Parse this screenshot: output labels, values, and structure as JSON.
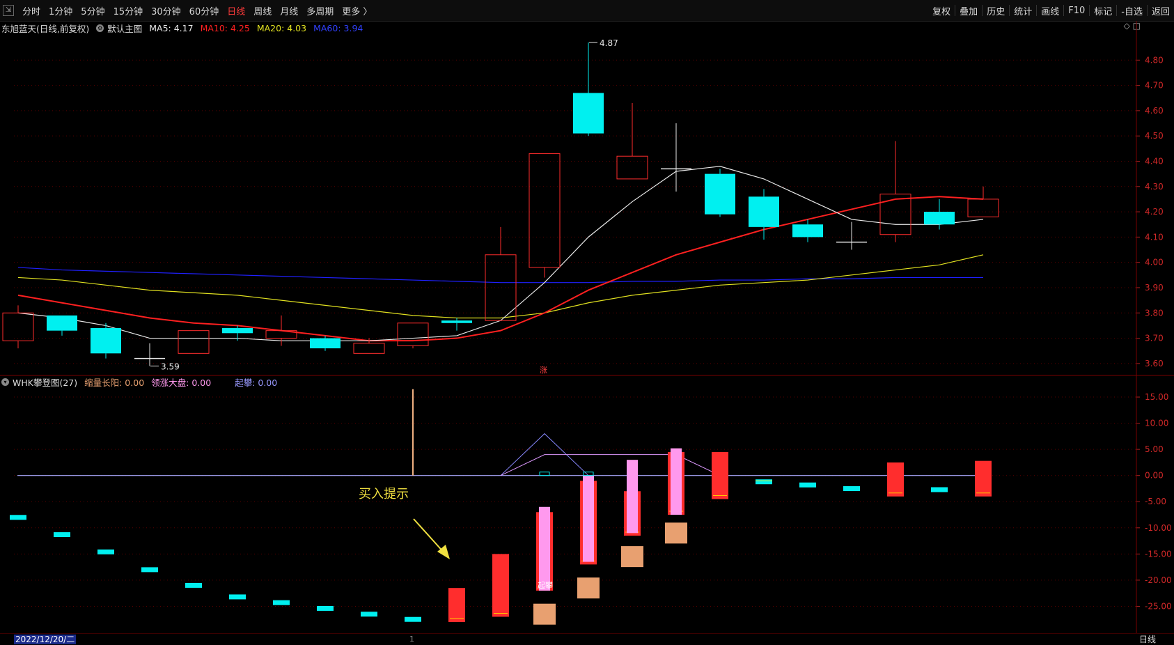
{
  "toolbar": {
    "periods": [
      "分时",
      "1分钟",
      "5分钟",
      "15分钟",
      "30分钟",
      "60分钟",
      "日线",
      "周线",
      "月线",
      "多周期",
      "更多 〉"
    ],
    "active_index": 6,
    "right": [
      "复权",
      "叠加",
      "历史",
      "统计",
      "画线",
      "F10",
      "标记",
      "-自选",
      "返回"
    ]
  },
  "info": {
    "stock": "东旭蓝天(日线,前复权)",
    "main_chart": "默认主图",
    "ma5": "MA5: 4.17",
    "ma10": "MA10: 4.25",
    "ma20": "MA20: 4.03",
    "ma60": "MA60: 3.94"
  },
  "indicator": {
    "name": "WHK攀登图(27)",
    "v1": "缩量长阳: 0.00",
    "v2": "领涨大盘: 0.00",
    "v3": "起攀: 0.00"
  },
  "colors": {
    "up": "#ff2d2d",
    "down": "#00f0f0",
    "ma5": "#e8e8e8",
    "ma10": "#ff2020",
    "ma20": "#e0e020",
    "ma60": "#2020ff",
    "pink": "#ff99ee",
    "orange": "#e8a070"
  },
  "chart_data": [
    {
      "type": "candlestick",
      "ylim": [
        3.55,
        4.9
      ],
      "ticks": [
        "4.80",
        "4.70",
        "4.60",
        "4.50",
        "4.40",
        "4.30",
        "4.20",
        "4.10",
        "4.00",
        "3.90",
        "3.80",
        "3.70",
        "3.60"
      ],
      "tick_values": [
        4.8,
        4.7,
        4.6,
        4.5,
        4.4,
        4.3,
        4.2,
        4.1,
        4.0,
        3.9,
        3.8,
        3.7,
        3.6
      ],
      "candles": [
        {
          "o": 3.69,
          "c": 3.8,
          "h": 3.83,
          "l": 3.66
        },
        {
          "o": 3.79,
          "c": 3.73,
          "h": 3.79,
          "l": 3.71
        },
        {
          "o": 3.74,
          "c": 3.64,
          "h": 3.76,
          "l": 3.62
        },
        {
          "o": 3.62,
          "c": 3.62,
          "h": 3.68,
          "l": 3.59
        },
        {
          "o": 3.64,
          "c": 3.73,
          "h": 3.73,
          "l": 3.64
        },
        {
          "o": 3.74,
          "c": 3.72,
          "h": 3.75,
          "l": 3.69
        },
        {
          "o": 3.7,
          "c": 3.73,
          "h": 3.79,
          "l": 3.67
        },
        {
          "o": 3.7,
          "c": 3.66,
          "h": 3.71,
          "l": 3.65
        },
        {
          "o": 3.64,
          "c": 3.68,
          "h": 3.7,
          "l": 3.64
        },
        {
          "o": 3.67,
          "c": 3.76,
          "h": 3.76,
          "l": 3.66
        },
        {
          "o": 3.77,
          "c": 3.76,
          "h": 3.78,
          "l": 3.73
        },
        {
          "o": 3.77,
          "c": 4.03,
          "h": 4.14,
          "l": 3.77
        },
        {
          "o": 3.98,
          "c": 4.43,
          "h": 4.43,
          "l": 3.94
        },
        {
          "o": 4.67,
          "c": 4.51,
          "h": 4.87,
          "l": 4.5
        },
        {
          "o": 4.33,
          "c": 4.42,
          "h": 4.63,
          "l": 4.33
        },
        {
          "o": 4.37,
          "c": 4.37,
          "h": 4.55,
          "l": 4.28
        },
        {
          "o": 4.35,
          "c": 4.19,
          "h": 4.37,
          "l": 4.18
        },
        {
          "o": 4.26,
          "c": 4.14,
          "h": 4.29,
          "l": 4.09
        },
        {
          "o": 4.15,
          "c": 4.1,
          "h": 4.17,
          "l": 4.08
        },
        {
          "o": 4.08,
          "c": 4.08,
          "h": 4.16,
          "l": 4.05
        },
        {
          "o": 4.11,
          "c": 4.27,
          "h": 4.48,
          "l": 4.08
        },
        {
          "o": 4.2,
          "c": 4.15,
          "h": 4.25,
          "l": 4.13
        },
        {
          "o": 4.18,
          "c": 4.25,
          "h": 4.3,
          "l": 4.18
        }
      ],
      "ma5": [
        3.8,
        3.78,
        3.75,
        3.7,
        3.7,
        3.7,
        3.69,
        3.69,
        3.69,
        3.7,
        3.71,
        3.77,
        3.92,
        4.1,
        4.24,
        4.36,
        4.38,
        4.33,
        4.25,
        4.17,
        4.15,
        4.15,
        4.17
      ],
      "ma10": [
        3.87,
        3.84,
        3.81,
        3.78,
        3.76,
        3.75,
        3.73,
        3.71,
        3.69,
        3.69,
        3.7,
        3.73,
        3.8,
        3.89,
        3.96,
        4.03,
        4.08,
        4.13,
        4.17,
        4.21,
        4.25,
        4.26,
        4.25
      ],
      "ma20": [
        3.94,
        3.93,
        3.91,
        3.89,
        3.88,
        3.87,
        3.85,
        3.83,
        3.81,
        3.79,
        3.78,
        3.78,
        3.8,
        3.84,
        3.87,
        3.89,
        3.91,
        3.92,
        3.93,
        3.95,
        3.97,
        3.99,
        4.03
      ],
      "ma60": [
        3.98,
        3.97,
        3.965,
        3.96,
        3.955,
        3.95,
        3.945,
        3.94,
        3.935,
        3.93,
        3.925,
        3.92,
        3.92,
        3.92,
        3.925,
        3.925,
        3.93,
        3.93,
        3.935,
        3.935,
        3.94,
        3.94,
        3.94
      ],
      "annotations": {
        "high": "4.87",
        "low": "3.59",
        "marker": "涨"
      }
    },
    {
      "type": "bar",
      "ylim": [
        -30,
        19
      ],
      "ticks": [
        "15.00",
        "10.00",
        "5.00",
        "0.00",
        "-5.00",
        "-10.00",
        "-15.00",
        "-20.00",
        "-25.00"
      ],
      "tick_values": [
        15,
        10,
        5,
        0,
        -5,
        -10,
        -15,
        -20,
        -25
      ],
      "cyan_levels": [
        -8,
        -11.3,
        -14.6,
        -18,
        -21,
        -23.2,
        -24.3,
        -25.4,
        -26.5,
        -27.5,
        null,
        null,
        null,
        null,
        null,
        null,
        null,
        -1.2,
        -1.8,
        -2.5,
        null,
        -2.7,
        null
      ],
      "red_bars": [
        null,
        null,
        null,
        null,
        null,
        null,
        null,
        null,
        null,
        null,
        [
          -28,
          -21.5
        ],
        [
          -27,
          -15
        ],
        [
          -22,
          -7
        ],
        [
          -17,
          -1
        ],
        [
          -11.5,
          -3
        ],
        [
          -7.5,
          4.5
        ],
        [
          -4.5,
          4.5
        ],
        null,
        null,
        null,
        [
          -4,
          2.5
        ],
        null,
        [
          -4,
          2.8
        ]
      ],
      "pink_bars": [
        null,
        null,
        null,
        null,
        null,
        null,
        null,
        null,
        null,
        null,
        null,
        null,
        [
          -22,
          -6
        ],
        [
          -16.5,
          0
        ],
        [
          -11,
          3
        ],
        [
          -7.5,
          5.2
        ],
        null,
        null,
        null,
        null,
        null,
        null,
        null
      ],
      "orange_boxes": [
        null,
        null,
        null,
        null,
        null,
        null,
        null,
        null,
        null,
        null,
        null,
        null,
        [
          -28.5,
          -24.5
        ],
        [
          -23.5,
          -19.5
        ],
        [
          -17.5,
          -13.5
        ],
        [
          -13,
          -9
        ],
        null,
        null,
        null,
        null,
        null,
        null,
        null
      ],
      "spike": {
        "index": 9,
        "value": 16.5
      },
      "label_buy": "买入提示",
      "label_rise": "起攀"
    }
  ],
  "bottom": {
    "date": "2022/12/20/二",
    "period": "日线",
    "cursor": "1"
  }
}
